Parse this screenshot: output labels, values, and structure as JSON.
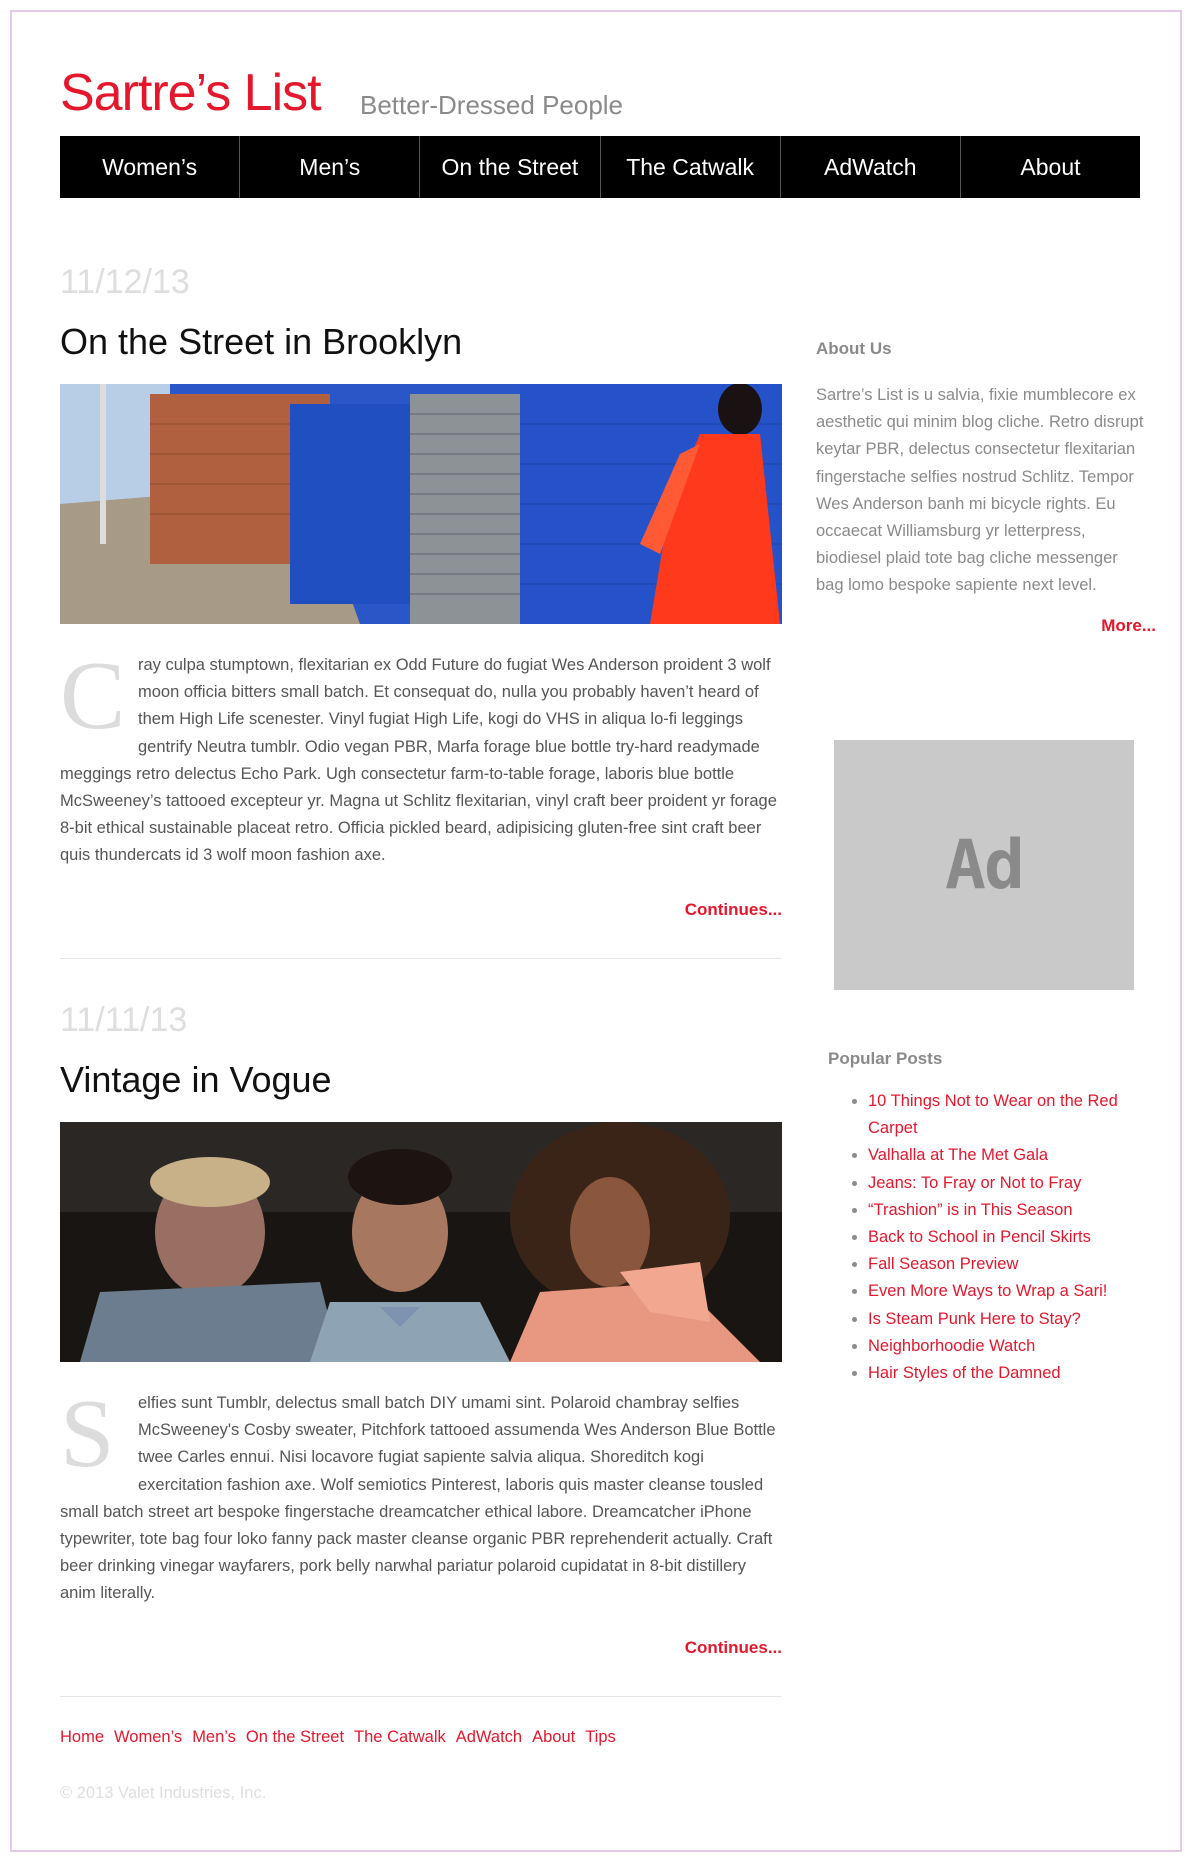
{
  "site": {
    "title": "Sartre’s List",
    "tagline": "Better-Dressed People"
  },
  "nav": {
    "items": [
      "Women’s",
      "Men’s",
      "On the Street",
      "The Catwalk",
      "AdWatch",
      "About"
    ]
  },
  "posts": [
    {
      "date": "11/12/13",
      "title": "On the Street in Brooklyn",
      "dropcap": "C",
      "body": "ray culpa stumptown, flexitarian ex Odd Future do fugiat Wes Anderson proident 3 wolf moon officia bitters small batch. Et consequat do, nulla you probably haven’t heard of them High Life scenester. Vinyl fugiat High Life, kogi do VHS in aliqua lo-fi leggings gentrify Neutra tumblr. Odio vegan PBR, Marfa forage blue bottle try-hard readymade meggings retro delectus Echo Park. Ugh consectetur farm-to-table forage, laboris blue bottle McSweeney’s tattooed excepteur yr. Magna ut Schlitz flexitarian, vinyl craft beer proident yr forage 8-bit ethical sustainable placeat retro. Officia pickled beard, adipisicing gluten-free sint craft beer quis thundercats id 3 wolf moon fashion axe.",
      "continues": "Continues..."
    },
    {
      "date": "11/11/13",
      "title": "Vintage in Vogue",
      "dropcap": "S",
      "body": "elfies sunt Tumblr, delectus small batch DIY umami sint. Polaroid chambray selfies McSweeney's Cosby sweater, Pitchfork tattooed assumenda Wes Anderson Blue Bottle twee Carles ennui. Nisi locavore fugiat sapiente salvia aliqua. Shoreditch kogi exercitation fashion axe. Wolf semiotics Pinterest, laboris quis master cleanse tousled small batch street art bespoke fingerstache dreamcatcher ethical labore. Dreamcatcher iPhone typewriter, tote bag four loko fanny pack master cleanse organic PBR reprehenderit actually. Craft beer drinking vinegar wayfarers, pork belly narwhal pariatur polaroid cupidatat in 8-bit distillery anim literally.",
      "continues": "Continues..."
    }
  ],
  "sidebar": {
    "about_title": "About Us",
    "about_text": "Sartre’s List is u salvia, fixie mumblecore ex aesthetic qui minim blog cliche. Retro disrupt keytar PBR, delectus consectetur flexitarian fingerstache selfies nostrud Schlitz. Tempor Wes Anderson banh mi bicycle rights. Eu occaecat Williamsburg yr letterpress, biodiesel plaid tote bag cliche messenger bag lomo bespoke sapiente next level.",
    "more_label": "More...",
    "ad_label": "Ad",
    "popular_title": "Popular Posts",
    "popular_items": [
      "10 Things Not to Wear on the Red Carpet",
      "Valhalla at The Met Gala",
      "Jeans: To Fray or Not to Fray",
      "“Trashion” is in This Season",
      "Back to School in Pencil Skirts",
      "Fall Season Preview",
      "Even More Ways to Wrap a Sari!",
      "Is Steam Punk Here to Stay?",
      "Neighborhoodie Watch",
      "Hair Styles of the Damned"
    ]
  },
  "footer": {
    "links": [
      "Home",
      "Women’s",
      "Men’s",
      "On the Street",
      "The Catwalk",
      "AdWatch",
      "About",
      "Tips"
    ],
    "copyright": "© 2013 Valet Industries, Inc."
  },
  "colors": {
    "accent": "#e4172d",
    "nav_bg": "#000000",
    "muted_text": "#8a8a8a",
    "date_text": "#dedede",
    "ad_bg": "#c9c9c9"
  }
}
